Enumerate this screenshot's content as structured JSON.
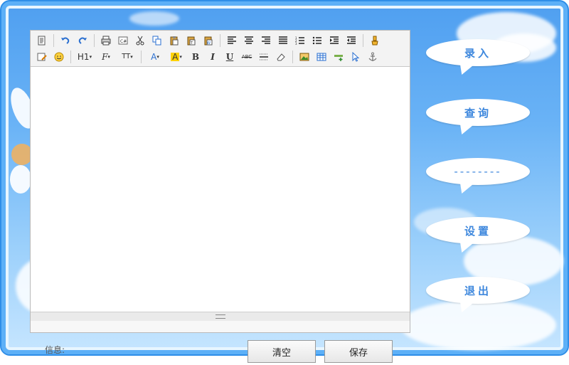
{
  "toolbar": {
    "h1": "H1",
    "font": "F",
    "fontsize": "TT",
    "fontcolor": "A",
    "bgcolor": "A",
    "bold": "B",
    "italic": "I",
    "underline": "U",
    "strike": "ABC"
  },
  "footer": {
    "info_label": "信息:",
    "clear_label": "清空",
    "save_label": "保存"
  },
  "menu": {
    "items": [
      {
        "label": "录入"
      },
      {
        "label": "查询"
      },
      {
        "label": "--------"
      },
      {
        "label": "设置"
      },
      {
        "label": "退出"
      }
    ]
  },
  "colors": {
    "accent": "#3d87dd",
    "frame": "#2e8ee8"
  }
}
